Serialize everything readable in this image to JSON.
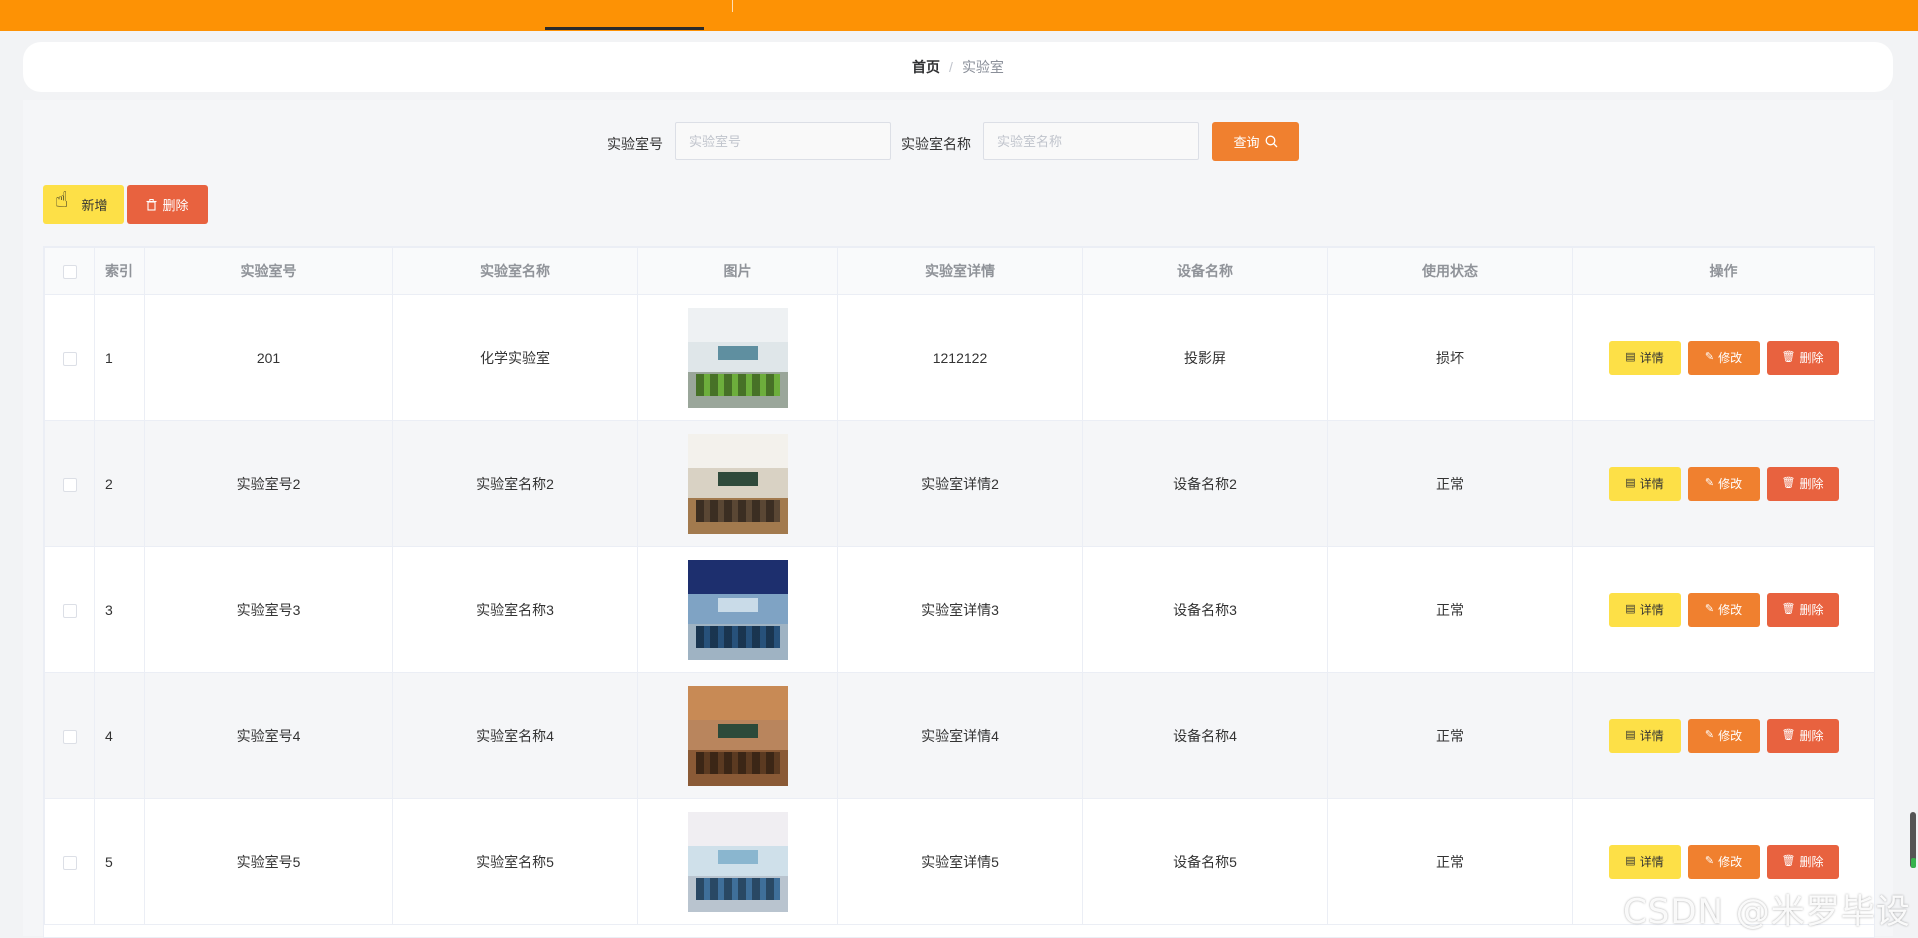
{
  "breadcrumb": {
    "home": "首页",
    "separator": "/",
    "current": "实验室"
  },
  "search": {
    "lab_no_label": "实验室号",
    "lab_no_placeholder": "实验室号",
    "lab_no_value": "",
    "lab_name_label": "实验室名称",
    "lab_name_placeholder": "实验室名称",
    "lab_name_value": "",
    "query_label": "查询",
    "query_icon": "search-icon"
  },
  "toolbar": {
    "add_label": "新增",
    "delete_label": "删除",
    "delete_icon": "trash-icon"
  },
  "table": {
    "headers": {
      "index": "索引",
      "lab_no": "实验室号",
      "lab_name": "实验室名称",
      "image": "图片",
      "lab_detail": "实验室详情",
      "device_name": "设备名称",
      "status": "使用状态",
      "actions": "操作"
    },
    "rows": [
      {
        "index": "1",
        "lab_no": "201",
        "lab_name": "化学实验室",
        "lab_detail": "1212122",
        "device_name": "投影屏",
        "status": "损坏"
      },
      {
        "index": "2",
        "lab_no": "实验室号2",
        "lab_name": "实验室名称2",
        "lab_detail": "实验室详情2",
        "device_name": "设备名称2",
        "status": "正常"
      },
      {
        "index": "3",
        "lab_no": "实验室号3",
        "lab_name": "实验室名称3",
        "lab_detail": "实验室详情3",
        "device_name": "设备名称3",
        "status": "正常"
      },
      {
        "index": "4",
        "lab_no": "实验室号4",
        "lab_name": "实验室名称4",
        "lab_detail": "实验室详情4",
        "device_name": "设备名称4",
        "status": "正常"
      },
      {
        "index": "5",
        "lab_no": "实验室号5",
        "lab_name": "实验室名称5",
        "lab_detail": "实验室详情5",
        "device_name": "设备名称5",
        "status": "正常"
      }
    ],
    "row_actions": {
      "detail": "详情",
      "edit": "修改",
      "delete": "删除"
    }
  },
  "colors": {
    "nav_bar": "#fd9205",
    "query_button": "#f0802f",
    "add_button": "#fde047",
    "delete_button": "#e8623f"
  },
  "watermark": "CSDN @米罗毕设"
}
